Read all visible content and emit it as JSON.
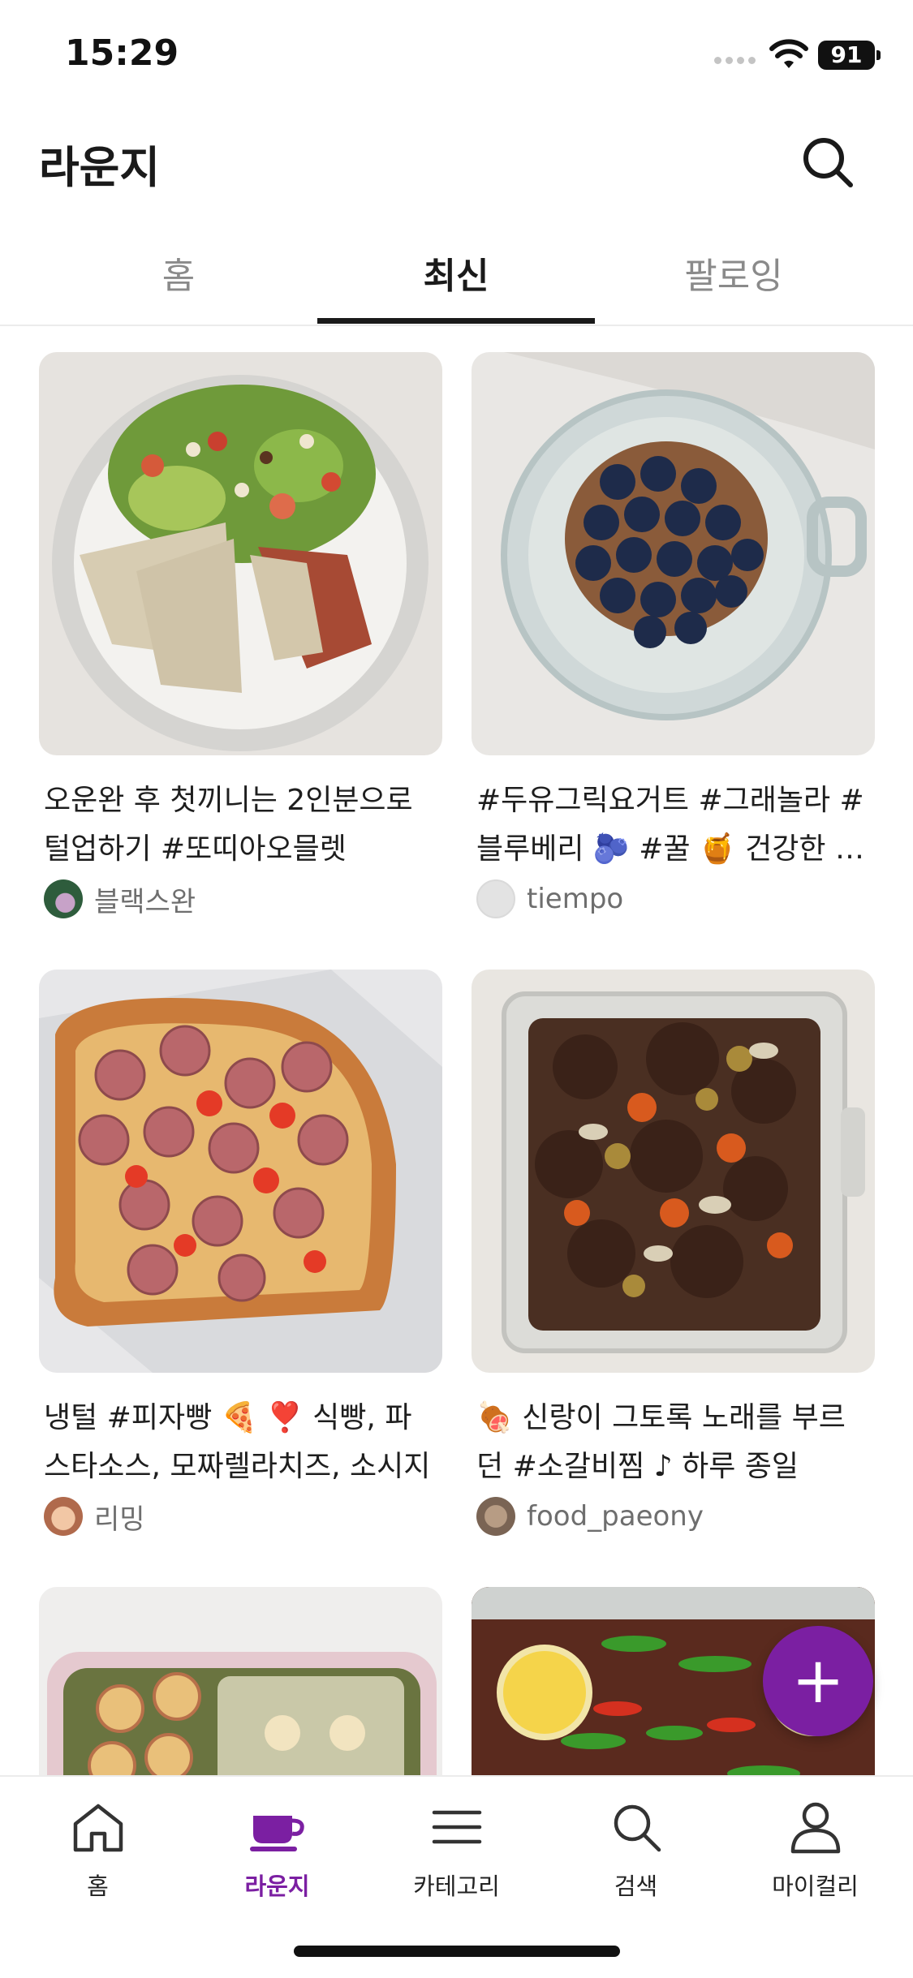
{
  "status_bar": {
    "time": "15:29",
    "battery": "91"
  },
  "header": {
    "title": "라운지",
    "search_icon": "search-icon"
  },
  "tabs": [
    {
      "label": "홈",
      "active": false
    },
    {
      "label": "최신",
      "active": true
    },
    {
      "label": "팔로잉",
      "active": false
    }
  ],
  "posts": [
    {
      "title": "오운완 후 첫끼니는 2인분으로 털업하기  #또띠아오믈렛",
      "author": "블랙스완",
      "image": "salad-plate-with-wraps"
    },
    {
      "title": "#두유그릭요거트 #그래놀라 #블루베리 🫐 #꿀 🍯  건강한 간식",
      "author": "tiempo",
      "image": "blueberry-yogurt-glass-bowl"
    },
    {
      "title": "냉털 #피자빵 🍕 ❣️  식빵, 파스타소스, 모짜렐라치즈, 소시지",
      "author": "리밍",
      "image": "sausage-pizza-toast"
    },
    {
      "title": "🍖 신랑이 그토록 노래를 부르던 #소갈비찜 ♪  하루 종일",
      "author": "food_paeony",
      "image": "braised-short-ribs"
    },
    {
      "title": "",
      "author": "",
      "image": "bento-lunch-box"
    },
    {
      "title": "",
      "author": "",
      "image": "pickled-shrimp-jar"
    }
  ],
  "fab": {
    "label": "+",
    "icon": "plus-icon"
  },
  "bottom_nav": [
    {
      "label": "홈",
      "icon": "home-icon",
      "active": false
    },
    {
      "label": "라운지",
      "icon": "coffee-cup-icon",
      "active": true
    },
    {
      "label": "카테고리",
      "icon": "menu-icon",
      "active": false
    },
    {
      "label": "검색",
      "icon": "search-icon",
      "active": false
    },
    {
      "label": "마이컬리",
      "icon": "person-icon",
      "active": false
    }
  ],
  "colors": {
    "accent": "#7b1fa2",
    "text": "#1e1e1e",
    "muted": "#8a8a8a"
  }
}
